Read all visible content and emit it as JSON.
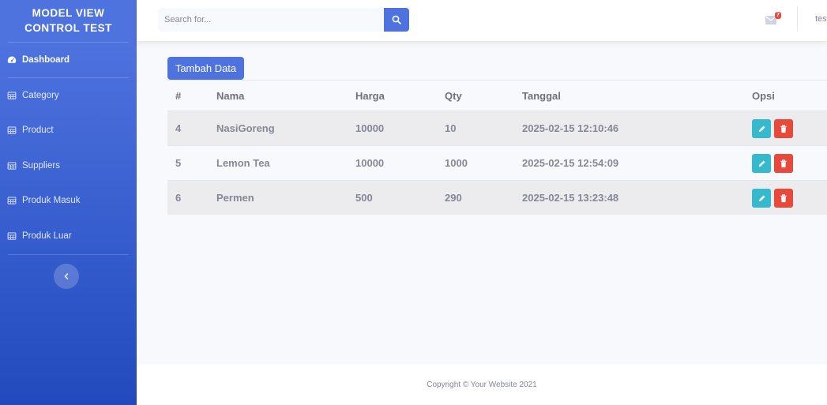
{
  "brand": {
    "line1": "MODEL VIEW",
    "line2": "CONTROL TEST"
  },
  "sidebar": {
    "items": [
      {
        "label": "Dashboard",
        "icon": "dashboard-icon",
        "active": true
      },
      {
        "label": "Category",
        "icon": "table-icon"
      },
      {
        "label": "Product",
        "icon": "table-icon"
      },
      {
        "label": "Suppliers",
        "icon": "table-icon"
      },
      {
        "label": "Produk Masuk",
        "icon": "table-icon"
      },
      {
        "label": "Produk Luar",
        "icon": "table-icon"
      }
    ],
    "toggle_icon": "chevron-left-icon"
  },
  "topbar": {
    "search_placeholder": "Search for...",
    "search_icon": "search-icon",
    "messages_icon": "envelope-icon",
    "messages_count": "7",
    "username": "test"
  },
  "content": {
    "add_button": "Tambah Data",
    "table": {
      "headers": [
        "#",
        "Nama",
        "Harga",
        "Qty",
        "Tanggal",
        "Opsi"
      ],
      "rows": [
        {
          "id": "4",
          "nama": "NasiGoreng",
          "harga": "10000",
          "qty": "10",
          "tanggal": "2025-02-15 12:10:46"
        },
        {
          "id": "5",
          "nama": "Lemon Tea",
          "harga": "10000",
          "qty": "1000",
          "tanggal": "2025-02-15 12:54:09"
        },
        {
          "id": "6",
          "nama": "Permen",
          "harga": "500",
          "qty": "290",
          "tanggal": "2025-02-15 13:23:48"
        }
      ],
      "edit_icon": "pencil-icon",
      "delete_icon": "trash-icon"
    }
  },
  "footer": {
    "text": "Copyright © Your Website 2021"
  },
  "colors": {
    "primary": "#4e73df",
    "info": "#36b9cc",
    "danger": "#e74a3b"
  }
}
